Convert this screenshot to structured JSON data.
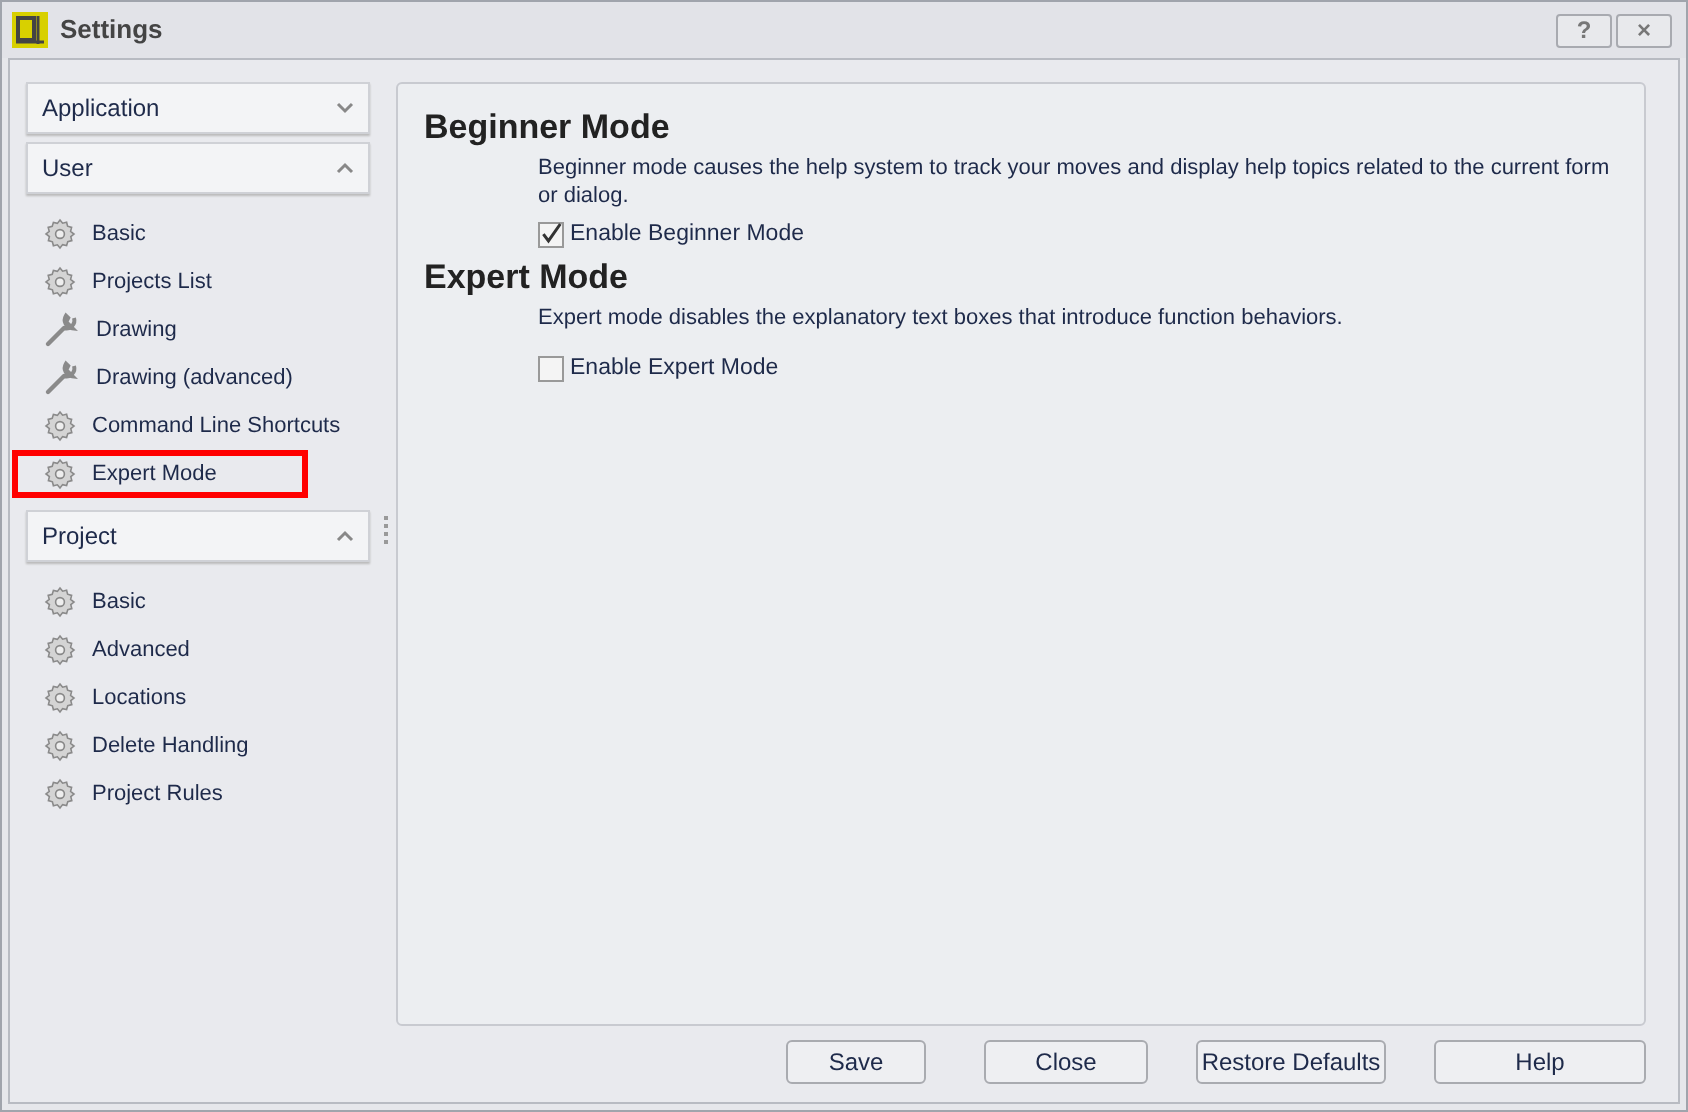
{
  "window": {
    "title": "Settings",
    "buttons": [
      "?",
      "×"
    ]
  },
  "sidebar": {
    "groups": [
      {
        "label": "Application",
        "expanded": false
      },
      {
        "label": "User",
        "expanded": true,
        "items": [
          {
            "label": "Basic",
            "kind": "gear",
            "highlighted": false
          },
          {
            "label": "Projects List",
            "kind": "gear",
            "highlighted": false
          },
          {
            "label": "Drawing",
            "kind": "wrench",
            "highlighted": false
          },
          {
            "label": "Drawing (advanced)",
            "kind": "wrench",
            "highlighted": false
          },
          {
            "label": "Command Line Shortcuts",
            "kind": "gear",
            "highlighted": false
          },
          {
            "label": "Expert Mode",
            "kind": "gear",
            "highlighted": true
          }
        ]
      },
      {
        "label": "Project",
        "expanded": true,
        "items": [
          {
            "label": "Basic",
            "kind": "gear",
            "highlighted": false
          },
          {
            "label": "Advanced",
            "kind": "gear",
            "highlighted": false
          },
          {
            "label": "Locations",
            "kind": "gear",
            "highlighted": false
          },
          {
            "label": "Delete Handling",
            "kind": "gear",
            "highlighted": false
          },
          {
            "label": "Project Rules",
            "kind": "gear",
            "highlighted": false
          }
        ]
      }
    ]
  },
  "sections": [
    {
      "heading": "Beginner Mode",
      "description": "Beginner mode causes the help system to track your moves and display help topics related to the current form or dialog.",
      "checkbox": {
        "label": "Enable Beginner Mode",
        "checked": true
      }
    },
    {
      "heading": "Expert Mode",
      "description": "Expert mode disables the explanatory text boxes that introduce function behaviors.",
      "checkbox": {
        "label": "Enable Expert Mode",
        "checked": false
      }
    }
  ],
  "buttons": [
    "Save",
    "Close",
    "Restore Defaults",
    "Help"
  ]
}
